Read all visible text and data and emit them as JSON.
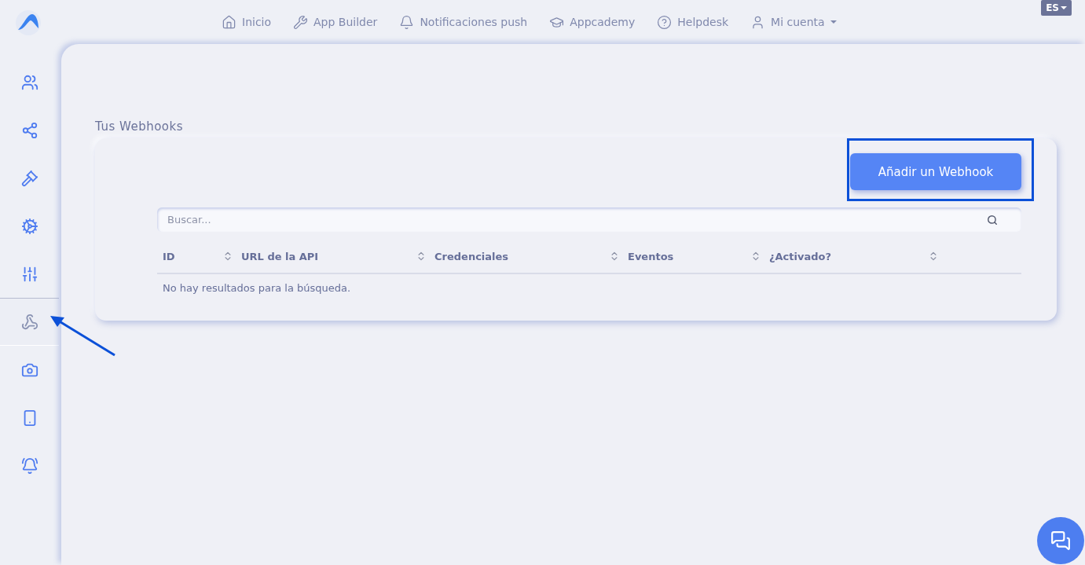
{
  "nav": [
    {
      "label": "Inicio"
    },
    {
      "label": "App Builder"
    },
    {
      "label": "Notificaciones push"
    },
    {
      "label": "Appcademy"
    },
    {
      "label": "Helpdesk"
    },
    {
      "label": "Mi cuenta",
      "dropdown": true
    }
  ],
  "language": {
    "label": "ES"
  },
  "sidebar": {
    "items": [
      {
        "selected": false
      },
      {
        "selected": false
      },
      {
        "selected": false
      },
      {
        "selected": false
      },
      {
        "selected": false
      },
      {
        "selected": true
      },
      {
        "selected": false
      },
      {
        "selected": false
      },
      {
        "selected": false
      }
    ]
  },
  "section_title": "Tus Webhooks",
  "add_button": {
    "label": "Añadir un Webhook",
    "highlighted": true
  },
  "search": {
    "placeholder": "Buscar..."
  },
  "table": {
    "columns": [
      "ID",
      "URL de la API",
      "Credenciales",
      "Eventos",
      "¿Activado?"
    ],
    "empty_message": "No hay resultados para la búsqueda."
  },
  "annotation_arrow": true
}
